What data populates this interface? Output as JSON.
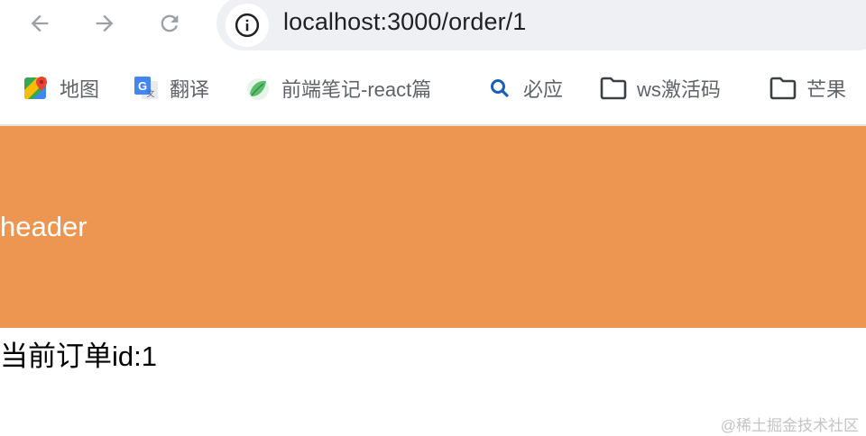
{
  "browser": {
    "url": "localhost:3000/order/1",
    "back_icon": "arrow-left-icon",
    "forward_icon": "arrow-right-icon",
    "reload_icon": "reload-icon",
    "info_icon": "info-icon"
  },
  "bookmarks": [
    {
      "label": "地图",
      "icon": "google-maps-icon"
    },
    {
      "label": "翻译",
      "icon": "google-translate-icon"
    },
    {
      "label": "前端笔记-react篇",
      "icon": "notes-green-icon"
    },
    {
      "label": "必应",
      "icon": "search-icon"
    },
    {
      "label": "ws激活码",
      "icon": "folder-icon"
    },
    {
      "label": "芒果",
      "icon": "folder-icon"
    }
  ],
  "page": {
    "header_text": "header",
    "order_text": "当前订单id:1"
  },
  "watermark": "@稀土掘金技术社区",
  "colors": {
    "header_bg": "#ec9652",
    "address_bar_bg": "#eef0f4"
  }
}
